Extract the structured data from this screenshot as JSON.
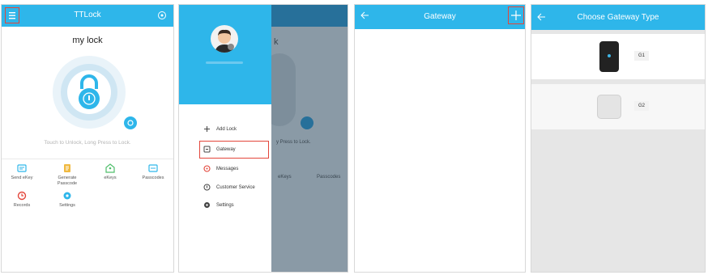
{
  "home": {
    "title": "TTLock",
    "lock_name": "my lock",
    "hint": "Touch to Unlock, Long Press to Lock.",
    "grid": [
      {
        "label": "Send eKey",
        "icon": "send-ekey-icon"
      },
      {
        "label": "Generate Passcode",
        "icon": "generate-passcode-icon"
      },
      {
        "label": "eKeys",
        "icon": "ekeys-icon"
      },
      {
        "label": "Passcodes",
        "icon": "passcodes-icon"
      },
      {
        "label": "Records",
        "icon": "records-icon"
      },
      {
        "label": "Settings",
        "icon": "settings-icon"
      }
    ]
  },
  "drawer": {
    "items": [
      {
        "label": "Add Lock",
        "icon": "plus-icon"
      },
      {
        "label": "Gateway",
        "icon": "gateway-icon"
      },
      {
        "label": "Messages",
        "icon": "message-icon"
      },
      {
        "label": "Customer Service",
        "icon": "service-icon"
      },
      {
        "label": "Settings",
        "icon": "gear-icon"
      }
    ],
    "behind_lock_name": "k",
    "behind_hint": "y Press to Lock.",
    "behind_ekeys": "eKeys",
    "behind_passcodes": "Passcodes"
  },
  "gateway": {
    "title": "Gateway"
  },
  "choose": {
    "title": "Choose Gateway Type",
    "types": [
      {
        "label": "G1"
      },
      {
        "label": "G2"
      }
    ]
  },
  "colors": {
    "primary": "#2eb6ea",
    "highlight": "#e3463b"
  }
}
